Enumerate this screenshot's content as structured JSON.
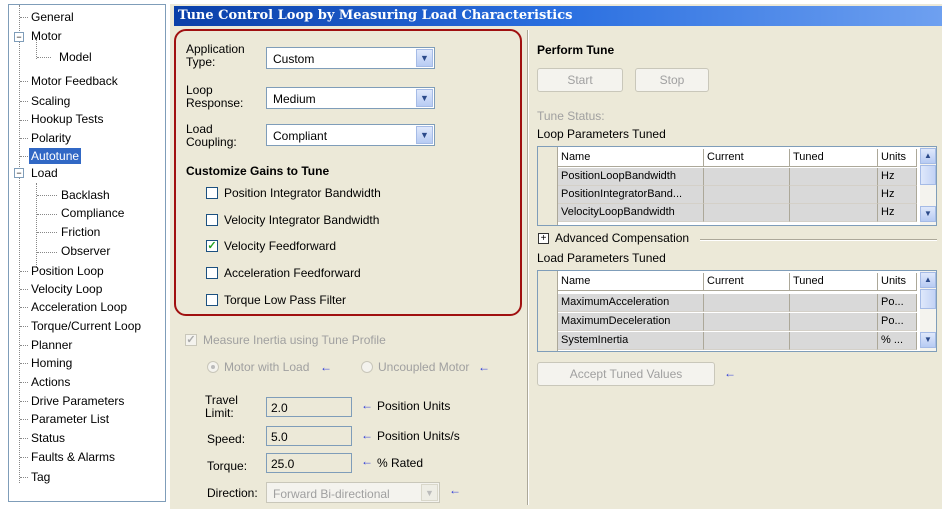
{
  "tree": {
    "items": [
      {
        "label": "General"
      },
      {
        "label": "Motor"
      },
      {
        "label": "Model"
      },
      {
        "label": "Motor Feedback"
      },
      {
        "label": "Scaling"
      },
      {
        "label": "Hookup Tests"
      },
      {
        "label": "Polarity"
      },
      {
        "label": "Autotune"
      },
      {
        "label": "Load"
      },
      {
        "label": "Backlash"
      },
      {
        "label": "Compliance"
      },
      {
        "label": "Friction"
      },
      {
        "label": "Observer"
      },
      {
        "label": "Position Loop"
      },
      {
        "label": "Velocity Loop"
      },
      {
        "label": "Acceleration Loop"
      },
      {
        "label": "Torque/Current Loop"
      },
      {
        "label": "Planner"
      },
      {
        "label": "Homing"
      },
      {
        "label": "Actions"
      },
      {
        "label": "Drive Parameters"
      },
      {
        "label": "Parameter List"
      },
      {
        "label": "Status"
      },
      {
        "label": "Faults & Alarms"
      },
      {
        "label": "Tag"
      }
    ],
    "selected": "Autotune"
  },
  "page": {
    "title": "Tune Control Loop by Measuring Load Characteristics"
  },
  "settings": {
    "application_type_label": "Application Type:",
    "application_type_value": "Custom",
    "loop_response_label": "Loop Response:",
    "loop_response_value": "Medium",
    "load_coupling_label": "Load Coupling:",
    "load_coupling_value": "Compliant"
  },
  "gains": {
    "heading": "Customize Gains to Tune",
    "items": [
      {
        "label": "Position Integrator Bandwidth",
        "checked": false
      },
      {
        "label": "Velocity Integrator Bandwidth",
        "checked": false
      },
      {
        "label": "Velocity Feedforward",
        "checked": true
      },
      {
        "label": "Acceleration Feedforward",
        "checked": false
      },
      {
        "label": "Torque Low Pass Filter",
        "checked": false
      }
    ]
  },
  "inertia": {
    "measure_label": "Measure Inertia using Tune Profile",
    "measure_checked": true,
    "motor_with_load": "Motor with Load",
    "uncoupled_motor": "Uncoupled Motor",
    "selected": "Motor with Load"
  },
  "profile": {
    "travel_limit_label": "Travel Limit:",
    "travel_limit_value": "2.0",
    "travel_limit_units": "Position Units",
    "speed_label": "Speed:",
    "speed_value": "5.0",
    "speed_units": "Position Units/s",
    "torque_label": "Torque:",
    "torque_value": "25.0",
    "torque_units": "% Rated",
    "direction_label": "Direction:",
    "direction_value": "Forward Bi-directional"
  },
  "tune": {
    "heading": "Perform Tune",
    "start_label": "Start",
    "stop_label": "Stop",
    "status_label": "Tune Status:",
    "loop_params_label": "Loop Parameters Tuned",
    "advanced_label": "Advanced Compensation",
    "load_params_label": "Load Parameters Tuned",
    "accept_label": "Accept Tuned Values"
  },
  "grid_headers": {
    "name": "Name",
    "current": "Current",
    "tuned": "Tuned",
    "units": "Units"
  },
  "loop_params": [
    {
      "name": "PositionLoopBandwidth",
      "current": "",
      "tuned": "",
      "units": "Hz"
    },
    {
      "name": "PositionIntegratorBand...",
      "current": "",
      "tuned": "",
      "units": "Hz"
    },
    {
      "name": "VelocityLoopBandwidth",
      "current": "",
      "tuned": "",
      "units": "Hz"
    }
  ],
  "load_params": [
    {
      "name": "MaximumAcceleration",
      "current": "",
      "tuned": "",
      "units": "Po..."
    },
    {
      "name": "MaximumDeceleration",
      "current": "",
      "tuned": "",
      "units": "Po..."
    },
    {
      "name": "SystemInertia",
      "current": "",
      "tuned": "",
      "units": "% ..."
    }
  ],
  "colors": {
    "title_bar": "#2a6fe0",
    "selection": "#3168c5",
    "highlight_box": "#a01010",
    "arrow": "#2d3bd8",
    "check": "#21a121"
  },
  "icons": {
    "expand_collapse": "minus-box-icon",
    "advanced_expand": "plus-box-icon",
    "info_arrow": "left-arrow-icon"
  }
}
